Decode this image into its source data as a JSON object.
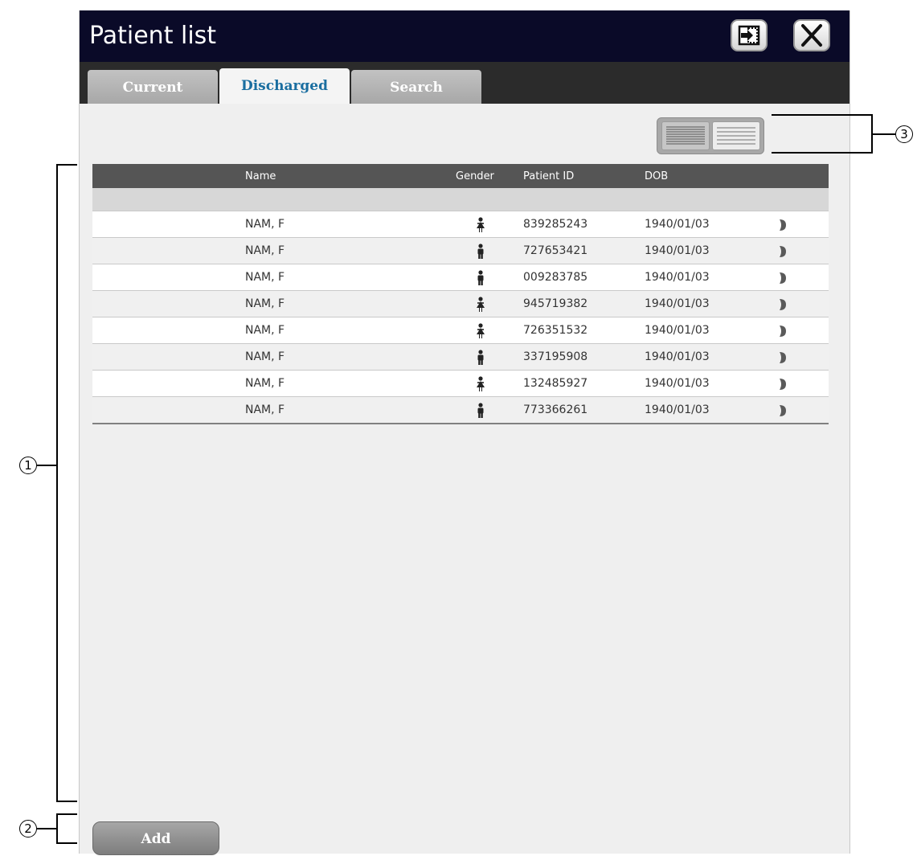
{
  "window": {
    "title": "Patient list"
  },
  "title_buttons": {
    "export_icon": "export-icon",
    "close_icon": "close-icon"
  },
  "tabs": [
    {
      "label": "Current",
      "active": false
    },
    {
      "label": "Discharged",
      "active": true
    },
    {
      "label": "Search",
      "active": false
    }
  ],
  "view_toggle": {
    "options": [
      "list-view-dense",
      "list-view-wide"
    ]
  },
  "table": {
    "columns": [
      "Name",
      "Gender",
      "Patient ID",
      "DOB"
    ],
    "rows": [
      {
        "name": "NAM, F",
        "gender": "female",
        "patient_id": "839285243",
        "dob": "1940/01/03"
      },
      {
        "name": "NAM, F",
        "gender": "male",
        "patient_id": "727653421",
        "dob": "1940/01/03"
      },
      {
        "name": "NAM, F",
        "gender": "male",
        "patient_id": "009283785",
        "dob": "1940/01/03"
      },
      {
        "name": "NAM, F",
        "gender": "female",
        "patient_id": "945719382",
        "dob": "1940/01/03"
      },
      {
        "name": "NAM, F",
        "gender": "female",
        "patient_id": "726351532",
        "dob": "1940/01/03"
      },
      {
        "name": "NAM, F",
        "gender": "male",
        "patient_id": "337195908",
        "dob": "1940/01/03"
      },
      {
        "name": "NAM, F",
        "gender": "female",
        "patient_id": "132485927",
        "dob": "1940/01/03"
      },
      {
        "name": "NAM, F",
        "gender": "male",
        "patient_id": "773366261",
        "dob": "1940/01/03"
      }
    ]
  },
  "footer": {
    "add_label": "Add"
  },
  "callouts": [
    "1",
    "2",
    "3"
  ]
}
